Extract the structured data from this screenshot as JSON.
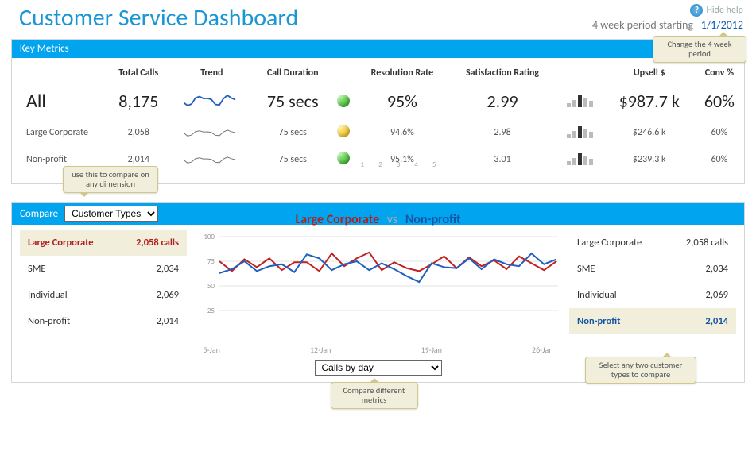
{
  "header": {
    "title": "Customer Service Dashboard",
    "help_text": "Hide help",
    "period_prefix": "4 week period starting",
    "period_date": "1/1/2012",
    "callout_period": "Change the 4 week period"
  },
  "key_metrics": {
    "panel_title": "Key Metrics",
    "columns": [
      "",
      "Total Calls",
      "Trend",
      "Call Duration",
      "",
      "Resolution Rate",
      "Satisfaction Rating",
      "",
      "Upsell $",
      "Conv %"
    ],
    "rows": [
      {
        "label": "All",
        "total_calls": "8,175",
        "duration": "75  secs",
        "res_dot": "green",
        "resolution": "95%",
        "satisfaction": "2.99",
        "upsell": "$987.7 k",
        "conv": "60%",
        "bold": true
      },
      {
        "label": "Large Corporate",
        "total_calls": "2,058",
        "duration": "75  secs",
        "res_dot": "yellow",
        "resolution": "94.6%",
        "satisfaction": "2.98",
        "upsell": "$246.6 k",
        "conv": "60%",
        "bold": false
      },
      {
        "label": "Non-profit",
        "total_calls": "2,014",
        "duration": "75  secs",
        "res_dot": "green",
        "resolution": "95.1%",
        "satisfaction": "3.01",
        "upsell": "$239.3 k",
        "conv": "60%",
        "bold": false
      }
    ],
    "rating_axis": "1  2  3  4  5",
    "callout_compare": "use this to compare on any dimension"
  },
  "compare": {
    "panel_title": "Compare",
    "dropdown_selected": "Customer Types",
    "series_a": "Large Corporate",
    "series_b": "Non-profit",
    "vs": "vs",
    "side_left": [
      {
        "label": "Large Corporate",
        "value": "2,058 calls",
        "selected": true
      },
      {
        "label": "SME",
        "value": "2,034",
        "selected": false
      },
      {
        "label": "Individual",
        "value": "2,069",
        "selected": false
      },
      {
        "label": "Non-profit",
        "value": "2,014",
        "selected": false
      }
    ],
    "side_right": [
      {
        "label": "Large Corporate",
        "value": "2,058 calls",
        "selected": false
      },
      {
        "label": "SME",
        "value": "2,034",
        "selected": false
      },
      {
        "label": "Individual",
        "value": "2,069",
        "selected": false
      },
      {
        "label": "Non-profit",
        "value": "2,014",
        "selected": true
      }
    ],
    "metric_selected": "Calls by day",
    "x_labels": [
      "5-Jan",
      "12-Jan",
      "19-Jan",
      "26-Jan"
    ],
    "y_labels": [
      "25",
      "50",
      "75",
      "100"
    ],
    "callout_metric": "Compare different metrics",
    "callout_select": "Select any two customer types to compare"
  },
  "chart_data": {
    "type": "line",
    "title": "Large Corporate vs Non-profit — Calls by day",
    "xlabel": "",
    "ylabel": "",
    "ylim": [
      0,
      100
    ],
    "x": [
      "5-Jan",
      "6-Jan",
      "7-Jan",
      "8-Jan",
      "9-Jan",
      "10-Jan",
      "11-Jan",
      "12-Jan",
      "13-Jan",
      "14-Jan",
      "15-Jan",
      "16-Jan",
      "17-Jan",
      "18-Jan",
      "19-Jan",
      "20-Jan",
      "21-Jan",
      "22-Jan",
      "23-Jan",
      "24-Jan",
      "25-Jan",
      "26-Jan",
      "27-Jan",
      "28-Jan",
      "29-Jan",
      "30-Jan",
      "31-Jan",
      "1-Feb"
    ],
    "series": [
      {
        "name": "Large Corporate",
        "color": "#c22121",
        "values": [
          75,
          65,
          77,
          69,
          78,
          66,
          74,
          74,
          65,
          83,
          70,
          78,
          84,
          66,
          74,
          68,
          65,
          72,
          80,
          68,
          79,
          70,
          76,
          67,
          80,
          73,
          66,
          75
        ]
      },
      {
        "name": "Non-profit",
        "color": "#1f5fbf",
        "values": [
          63,
          67,
          75,
          65,
          70,
          72,
          64,
          82,
          78,
          66,
          72,
          75,
          66,
          73,
          67,
          60,
          54,
          73,
          69,
          68,
          78,
          67,
          77,
          72,
          70,
          83,
          72,
          77
        ]
      }
    ]
  }
}
